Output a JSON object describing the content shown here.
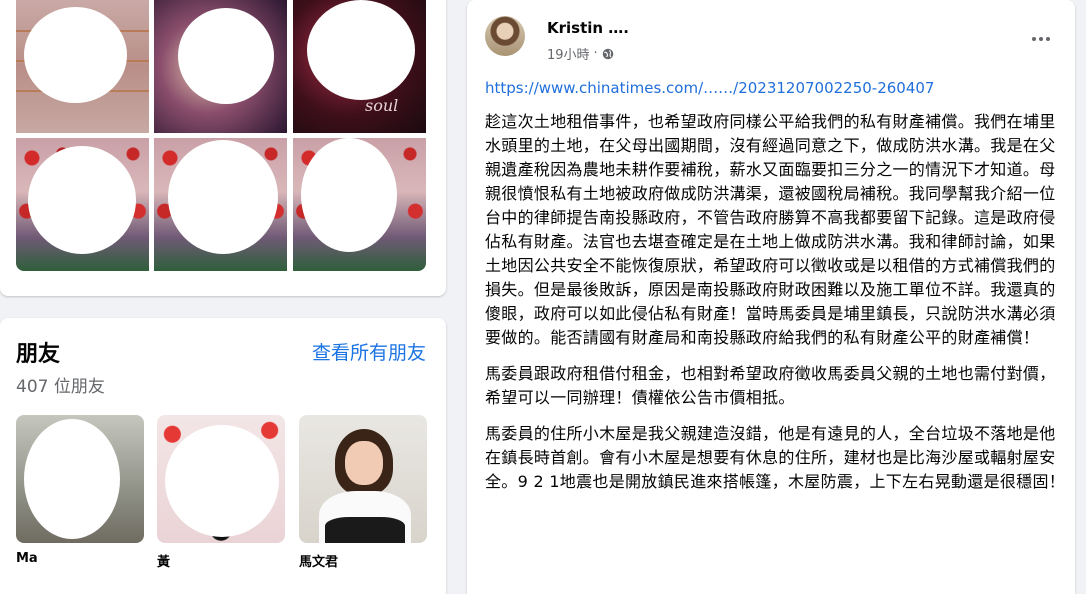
{
  "photos": [
    {
      "name": "photo-1"
    },
    {
      "name": "photo-2",
      "overlay_text": "soul"
    },
    {
      "name": "photo-3"
    },
    {
      "name": "photo-4"
    },
    {
      "name": "photo-5"
    },
    {
      "name": "photo-6"
    }
  ],
  "friends": {
    "title": "朋友",
    "count_text": "407 位朋友",
    "see_all": "查看所有朋友",
    "items": [
      {
        "name": "Ma"
      },
      {
        "name": "黃"
      },
      {
        "name": "馬文君"
      }
    ]
  },
  "post": {
    "author": "Kristin ….",
    "time": "19小時",
    "separator": "·",
    "privacy_icon": "globe-icon",
    "link": "https://www.chinatimes.com/……/20231207002250-260407",
    "paragraphs": [
      "趁這次土地租借事件，也希望政府同樣公平給我們的私有財產補償。我們在埔里水頭里的土地，在父母出國期間，沒有經過同意之下，做成防洪水溝。我是在父親遺產稅因為農地未耕作要補稅，薪水又面臨要扣三分之一的情況下才知道。母親很憤恨私有土地被政府做成防洪溝渠，還被國稅局補稅。我同學幫我介紹一位台中的律師提告南投縣政府，不管告政府勝算不高我都要留下記錄。這是政府侵佔私有財產。法官也去堪查確定是在土地上做成防洪水溝。我和律師討論，如果土地因公共安全不能恢復原狀，希望政府可以徵收或是以租借的方式補償我們的損失。但是最後敗訴，原因是南投縣政府財政困難以及施工單位不詳。我還真的傻眼，政府可以如此侵佔私有財產！當時馬委員是埔里鎮長，只說防洪水溝必須要做的。能否請國有財產局和南投縣政府給我們的私有財產公平的財產補償！",
      "馬委員跟政府租借付租金，也相對希望政府徵收馬委員父親的土地也需付對價，希望可以一同辦理！債權依公告市價相抵。",
      "馬委員的住所小木屋是我父親建造沒錯，他是有遠見的人，全台垃圾不落地是他在鎮長時首創。會有小木屋是想要有休息的住所，建材也是比海沙屋或輻射屋安全。9 2 1地震也是開放鎮民進來搭帳篷，木屋防震，上下左右晃動還是很穩固！"
    ]
  }
}
